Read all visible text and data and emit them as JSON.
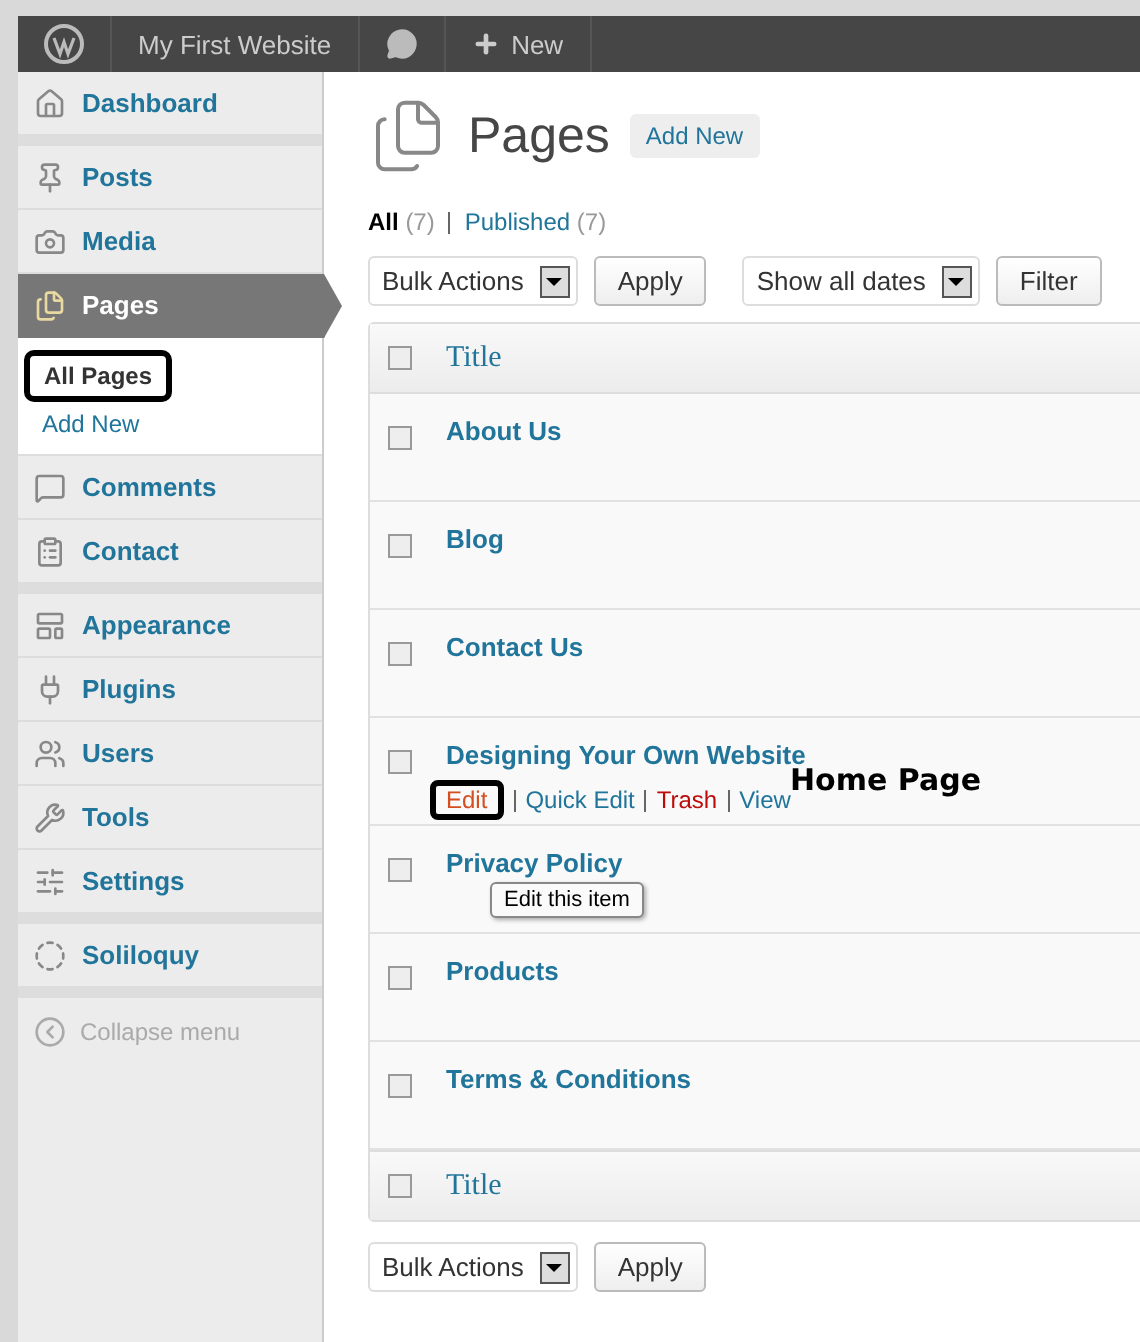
{
  "admin_bar": {
    "site_name": "My First Website",
    "new_label": "New"
  },
  "sidebar": {
    "groups": [
      [
        {
          "label": "Dashboard",
          "selected": false
        }
      ],
      [
        {
          "label": "Posts",
          "selected": false
        },
        {
          "label": "Media",
          "selected": false
        },
        {
          "label": "Pages",
          "selected": true,
          "children": [
            {
              "label": "All Pages",
              "selected": true,
              "annotated": true
            },
            {
              "label": "Add New",
              "selected": false,
              "annotated": false
            }
          ]
        },
        {
          "label": "Comments",
          "selected": false
        },
        {
          "label": "Contact",
          "selected": false
        }
      ],
      [
        {
          "label": "Appearance",
          "selected": false
        },
        {
          "label": "Plugins",
          "selected": false
        },
        {
          "label": "Users",
          "selected": false
        },
        {
          "label": "Tools",
          "selected": false
        },
        {
          "label": "Settings",
          "selected": false
        }
      ],
      [
        {
          "label": "Soliloquy",
          "selected": false
        }
      ]
    ],
    "collapse_label": "Collapse menu"
  },
  "page": {
    "title": "Pages",
    "add_new": "Add New"
  },
  "filters": [
    {
      "label": "All",
      "count": "(7)",
      "selected": true
    },
    {
      "label": "Published",
      "count": "(7)",
      "selected": false
    }
  ],
  "top_actions": {
    "bulk": "Bulk Actions",
    "apply": "Apply",
    "dates": "Show all dates",
    "filter": "Filter"
  },
  "table": {
    "header": {
      "title": "Title",
      "checked": false
    },
    "footer": {
      "title": "Title",
      "checked": false
    },
    "rows": [
      {
        "title": "About Us",
        "checked": false
      },
      {
        "title": "Blog",
        "checked": false
      },
      {
        "title": "Contact Us",
        "checked": false
      },
      {
        "title": "Designing Your Own Website",
        "checked": false,
        "actions": [
          {
            "label": "Edit",
            "kind": "edit",
            "annotated": true
          },
          {
            "label": "Quick Edit",
            "kind": "link",
            "annotated": false
          },
          {
            "label": "Trash",
            "kind": "trash",
            "annotated": false
          },
          {
            "label": "View",
            "kind": "link",
            "annotated": false
          }
        ],
        "note": "Home Page"
      },
      {
        "title": "Privacy Policy",
        "checked": false,
        "tooltip": "Edit this item"
      },
      {
        "title": "Products",
        "checked": false
      },
      {
        "title": "Terms & Conditions",
        "checked": false
      }
    ]
  },
  "bottom_actions": {
    "bulk": "Bulk Actions",
    "apply": "Apply"
  }
}
